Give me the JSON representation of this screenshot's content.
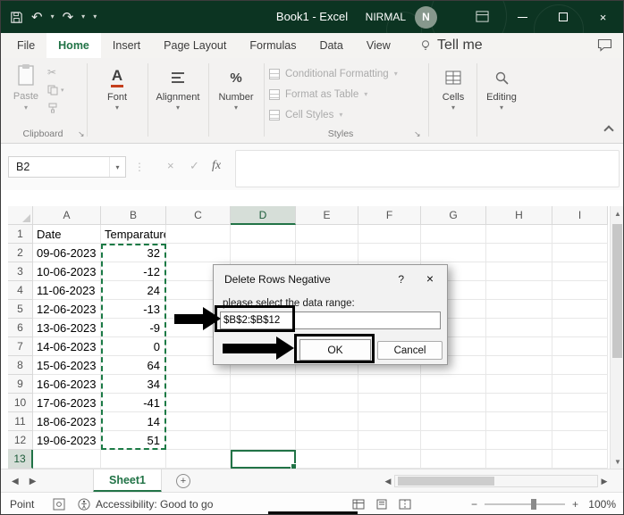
{
  "titlebar": {
    "title": "Book1  -  Excel",
    "user_name": "NIRMAL",
    "avatar_letter": "N"
  },
  "ribbon": {
    "tabs": [
      "File",
      "Home",
      "Insert",
      "Page Layout",
      "Formulas",
      "Data",
      "View"
    ],
    "active_tab": "Home",
    "tell_me": "Tell me",
    "groups": {
      "paste": "Paste",
      "clipboard": "Clipboard",
      "font": "Font",
      "alignment": "Alignment",
      "number": "Number",
      "styles": "Styles",
      "cells": "Cells",
      "editing": "Editing"
    },
    "styles_buttons": [
      "Conditional Formatting",
      "Format as Table",
      "Cell Styles"
    ]
  },
  "formula_bar": {
    "name_box": "B2",
    "fx": "fx",
    "formula_value": ""
  },
  "grid": {
    "columns": [
      "A",
      "B",
      "C",
      "D",
      "E",
      "F",
      "G",
      "H",
      "I"
    ],
    "rows": [
      {
        "n": "1",
        "A": "Date",
        "B": "Temparature"
      },
      {
        "n": "2",
        "A": "09-06-2023",
        "B": "32"
      },
      {
        "n": "3",
        "A": "10-06-2023",
        "B": "-12"
      },
      {
        "n": "4",
        "A": "11-06-2023",
        "B": "24"
      },
      {
        "n": "5",
        "A": "12-06-2023",
        "B": "-13"
      },
      {
        "n": "6",
        "A": "13-06-2023",
        "B": "-9"
      },
      {
        "n": "7",
        "A": "14-06-2023",
        "B": "0"
      },
      {
        "n": "8",
        "A": "15-06-2023",
        "B": "64"
      },
      {
        "n": "9",
        "A": "16-06-2023",
        "B": "34"
      },
      {
        "n": "10",
        "A": "17-06-2023",
        "B": "-41"
      },
      {
        "n": "11",
        "A": "18-06-2023",
        "B": "14"
      },
      {
        "n": "12",
        "A": "19-06-2023",
        "B": "51"
      },
      {
        "n": "13",
        "A": "",
        "B": ""
      }
    ],
    "selection": {
      "marching_ants_range": "B2:B12",
      "active_cell": "D13",
      "highlighted_column": "D",
      "highlighted_row": "13"
    }
  },
  "dialog": {
    "title": "Delete Rows Negative",
    "help": "?",
    "close": "×",
    "label": "please select the data range:",
    "range_value": "$B$2:$B$12",
    "ok": "OK",
    "cancel": "Cancel"
  },
  "sheet_bar": {
    "tab_label": "Sheet1"
  },
  "status_bar": {
    "mode": "Point",
    "accessibility": "Accessibility: Good to go",
    "zoom_out": "−",
    "zoom_in": "+",
    "zoom_level": "100%"
  },
  "colors": {
    "accent_green": "#217346",
    "titlebar_green": "#0c3422",
    "marching_ants": "#1b7a45",
    "annotation_black": "#000000"
  }
}
